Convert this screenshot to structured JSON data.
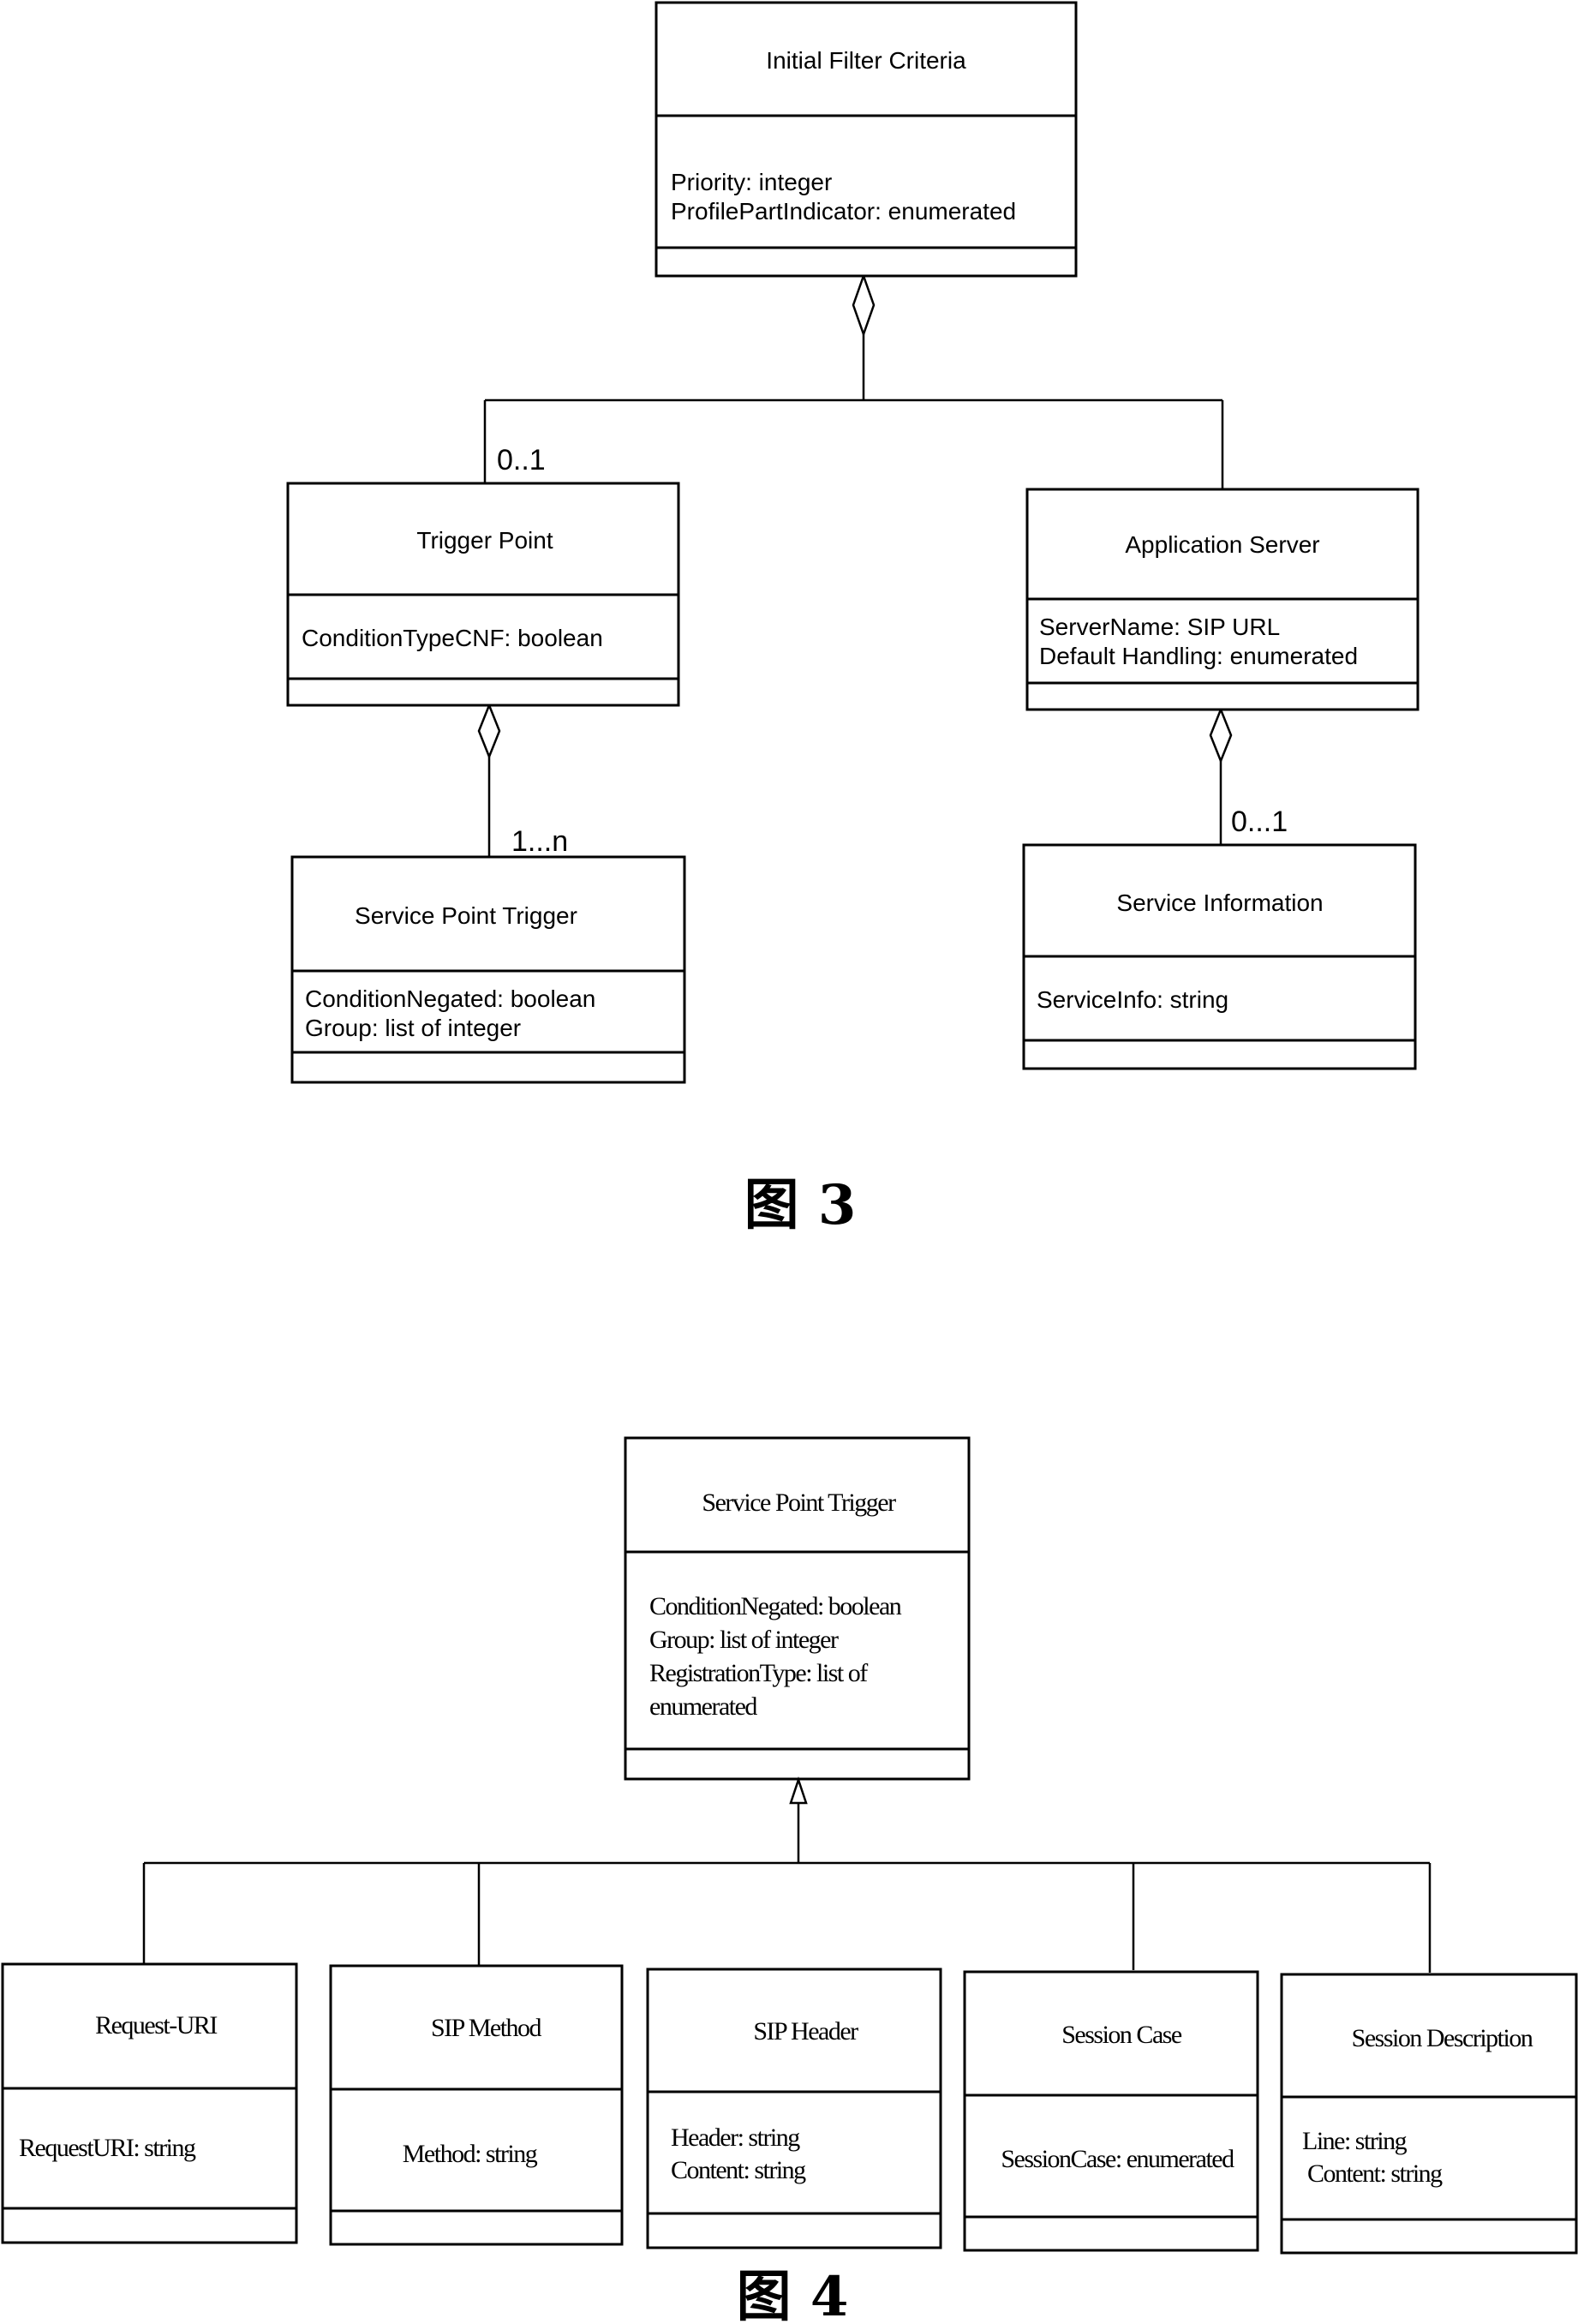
{
  "figure3": {
    "caption": "图 3",
    "classes": {
      "initial_filter_criteria": {
        "name": "Initial Filter Criteria",
        "attributes": [
          "Priority: integer",
          "ProfilePartIndicator: enumerated"
        ]
      },
      "trigger_point": {
        "name": "Trigger Point",
        "attributes": [
          "ConditionTypeCNF: boolean"
        ]
      },
      "application_server": {
        "name": "Application Server",
        "attributes": [
          "ServerName: SIP URL",
          "Default Handling: enumerated"
        ]
      },
      "service_point_trigger": {
        "name": "Service Point Trigger",
        "attributes": [
          "ConditionNegated: boolean",
          "Group: list of integer"
        ]
      },
      "service_information": {
        "name": "Service Information",
        "attributes": [
          "ServiceInfo: string"
        ]
      }
    },
    "multiplicities": {
      "trigger_point": "0..1",
      "service_point_trigger": "1...n",
      "service_information": "0...1"
    }
  },
  "figure4": {
    "caption": "图 4",
    "parent": {
      "name": "Service Point Trigger",
      "attributes": [
        "ConditionNegated: boolean",
        "Group: list of integer",
        "RegistrationType: list of",
        "enumerated"
      ]
    },
    "children": [
      {
        "name": "Request-URI",
        "attributes": [
          "RequestURI: string"
        ]
      },
      {
        "name": "SIP Method",
        "attributes": [
          "Method: string"
        ]
      },
      {
        "name": "SIP Header",
        "attributes": [
          "Header: string",
          "Content: string"
        ]
      },
      {
        "name": "Session Case",
        "attributes": [
          "SessionCase: enumerated"
        ]
      },
      {
        "name": "Session Description",
        "attributes": [
          "Line: string",
          " Content: string"
        ]
      }
    ]
  }
}
